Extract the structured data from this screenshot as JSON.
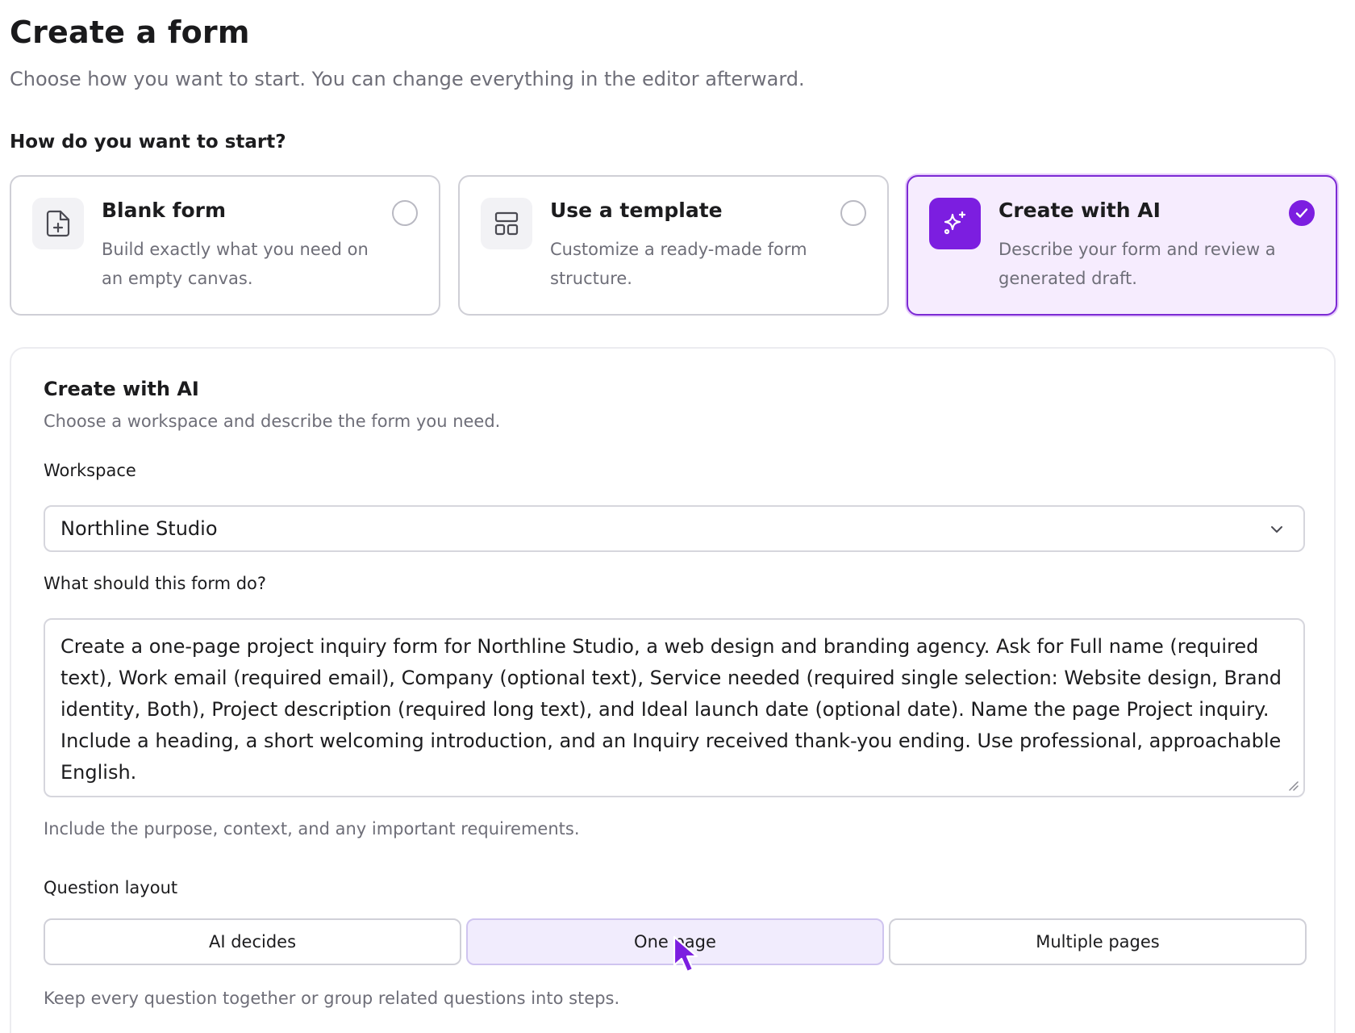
{
  "header": {
    "title": "Create a form",
    "subtitle": "Choose how you want to start. You can change everything in the editor afterward."
  },
  "start": {
    "label": "How do you want to start?",
    "options": [
      {
        "title": "Blank form",
        "description": "Build exactly what you need on an empty canvas.",
        "icon": "file-plus-icon",
        "selected": false
      },
      {
        "title": "Use a template",
        "description": "Customize a ready-made form structure.",
        "icon": "layout-template-icon",
        "selected": false
      },
      {
        "title": "Create with AI",
        "description": "Describe your form and review a generated draft.",
        "icon": "sparkles-icon",
        "selected": true
      }
    ]
  },
  "ai_panel": {
    "title": "Create with AI",
    "description": "Choose a workspace and describe the form you need.",
    "workspace": {
      "label": "Workspace",
      "value": "Northline Studio"
    },
    "prompt": {
      "label": "What should this form do?",
      "value": "Create a one-page project inquiry form for Northline Studio, a web design and branding agency. Ask for Full name (required text), Work email (required email), Company (optional text), Service needed (required single selection: Website design, Brand identity, Both), Project description (required long text), and Ideal launch date (optional date). Name the page Project inquiry. Include a heading, a short welcoming introduction, and an Inquiry received thank-you ending. Use professional, approachable English.",
      "help": "Include the purpose, context, and any important requirements."
    },
    "layout": {
      "label": "Question layout",
      "options": [
        "AI decides",
        "One page",
        "Multiple pages"
      ],
      "selected": "One page",
      "help": "Keep every question together or group related questions into steps."
    }
  },
  "colors": {
    "accent": "#7c1ee0",
    "selected_card_bg": "#f6ecfe",
    "segment_active_bg": "#f1ecfd"
  }
}
